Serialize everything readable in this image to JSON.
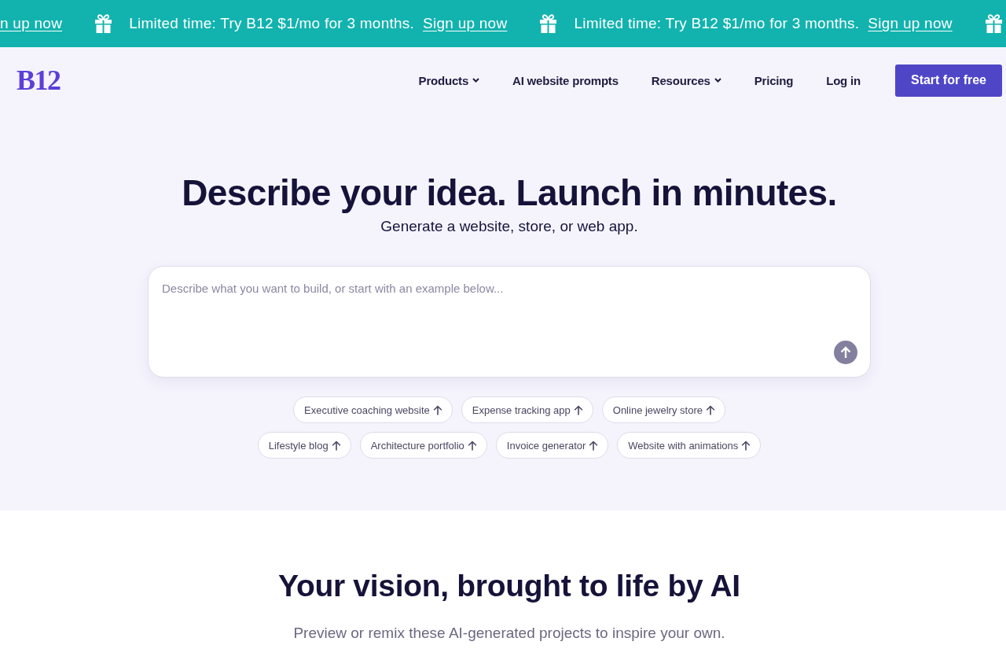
{
  "promo_banner": {
    "segments": [
      {
        "kind": "link",
        "link": "n up now"
      },
      {
        "kind": "promo",
        "text": "Limited time: Try B12 $1/mo for 3 months.",
        "link": "Sign up now"
      },
      {
        "kind": "promo",
        "text": "Limited time: Try B12 $1/mo for 3 months.",
        "link": "Sign up now"
      },
      {
        "kind": "gift"
      }
    ]
  },
  "nav": {
    "logo": "B12",
    "items": [
      {
        "label": "Products",
        "dropdown": true
      },
      {
        "label": "AI website prompts",
        "dropdown": false
      },
      {
        "label": "Resources",
        "dropdown": true
      },
      {
        "label": "Pricing",
        "dropdown": false
      },
      {
        "label": "Log in",
        "dropdown": false
      }
    ],
    "cta": "Start for free"
  },
  "hero": {
    "title": "Describe your idea. Launch in minutes.",
    "subtitle": "Generate a website, store, or web app.",
    "prompt": {
      "placeholder": "Describe what you want to build, or start with an example below..."
    },
    "example_rows": [
      [
        "Executive coaching website",
        "Expense tracking app",
        "Online jewelry store"
      ],
      [
        "Lifestyle blog",
        "Architecture portfolio",
        "Invoice generator",
        "Website with animations"
      ]
    ]
  },
  "showcase": {
    "title": "Your vision, brought to life by AI",
    "subtitle": "Preview or remix these AI-generated projects to inspire your own."
  }
}
